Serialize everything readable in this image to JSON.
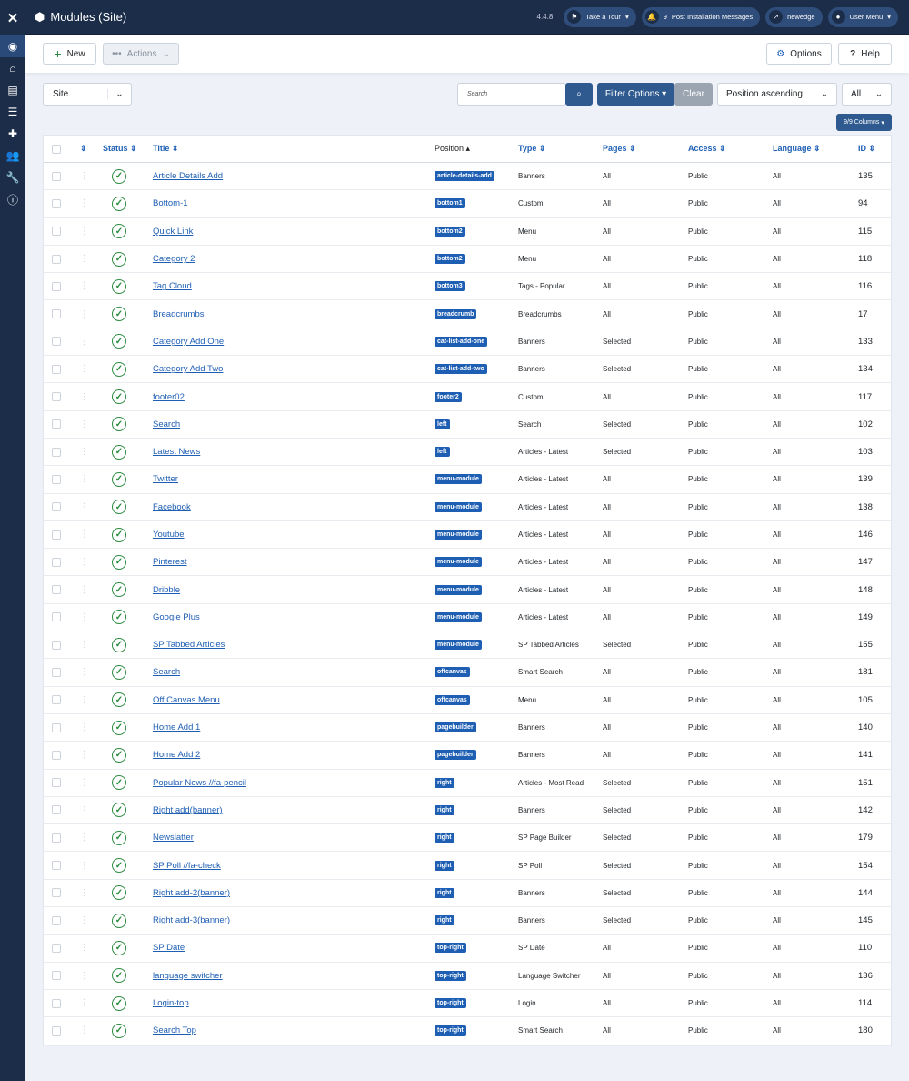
{
  "header": {
    "title": "Modules (Site)",
    "version": "4.4.8",
    "take_tour": "Take a Tour",
    "notif_count": "9",
    "post_install": "Post Installation Messages",
    "site_name": "newedge",
    "user_menu": "User Menu"
  },
  "toolbar": {
    "new": "New",
    "actions": "Actions",
    "options": "Options",
    "help": "Help"
  },
  "filters": {
    "client": "Site",
    "search_placeholder": "Search",
    "filter_options": "Filter Options",
    "clear": "Clear",
    "ordering": "Position ascending",
    "limit": "All",
    "columns": "9/9 Columns"
  },
  "table": {
    "headers": {
      "status": "Status",
      "title": "Title",
      "position": "Position",
      "type": "Type",
      "pages": "Pages",
      "access": "Access",
      "language": "Language",
      "id": "ID"
    },
    "rows": [
      [
        "Article Details Add",
        "article-details-add",
        "Banners",
        "All",
        "Public",
        "All",
        "135"
      ],
      [
        "Bottom-1",
        "bottom1",
        "Custom",
        "All",
        "Public",
        "All",
        "94"
      ],
      [
        "Quick Link",
        "bottom2",
        "Menu",
        "All",
        "Public",
        "All",
        "115"
      ],
      [
        "Category 2",
        "bottom2",
        "Menu",
        "All",
        "Public",
        "All",
        "118"
      ],
      [
        "Tag Cloud",
        "bottom3",
        "Tags - Popular",
        "All",
        "Public",
        "All",
        "116"
      ],
      [
        "Breadcrumbs",
        "breadcrumb",
        "Breadcrumbs",
        "All",
        "Public",
        "All",
        "17"
      ],
      [
        "Category Add One",
        "cat-list-add-one",
        "Banners",
        "Selected",
        "Public",
        "All",
        "133"
      ],
      [
        "Category Add Two",
        "cat-list-add-two",
        "Banners",
        "Selected",
        "Public",
        "All",
        "134"
      ],
      [
        "footer02",
        "footer2",
        "Custom",
        "All",
        "Public",
        "All",
        "117"
      ],
      [
        "Search",
        "left",
        "Search",
        "Selected",
        "Public",
        "All",
        "102"
      ],
      [
        "Latest News",
        "left",
        "Articles - Latest",
        "Selected",
        "Public",
        "All",
        "103"
      ],
      [
        "Twitter",
        "menu-module",
        "Articles - Latest",
        "All",
        "Public",
        "All",
        "139"
      ],
      [
        "Facebook",
        "menu-module",
        "Articles - Latest",
        "All",
        "Public",
        "All",
        "138"
      ],
      [
        "Youtube",
        "menu-module",
        "Articles - Latest",
        "All",
        "Public",
        "All",
        "146"
      ],
      [
        "Pinterest",
        "menu-module",
        "Articles - Latest",
        "All",
        "Public",
        "All",
        "147"
      ],
      [
        "Dribble",
        "menu-module",
        "Articles - Latest",
        "All",
        "Public",
        "All",
        "148"
      ],
      [
        "Google Plus",
        "menu-module",
        "Articles - Latest",
        "All",
        "Public",
        "All",
        "149"
      ],
      [
        "SP Tabbed Articles",
        "menu-module",
        "SP Tabbed Articles",
        "Selected",
        "Public",
        "All",
        "155"
      ],
      [
        "Search",
        "offcanvas",
        "Smart Search",
        "All",
        "Public",
        "All",
        "181"
      ],
      [
        "Off Canvas Menu",
        "offcanvas",
        "Menu",
        "All",
        "Public",
        "All",
        "105"
      ],
      [
        "Home Add 1",
        "pagebuilder",
        "Banners",
        "All",
        "Public",
        "All",
        "140"
      ],
      [
        "Home Add 2",
        "pagebuilder",
        "Banners",
        "All",
        "Public",
        "All",
        "141"
      ],
      [
        "Popular News //fa-pencil",
        "right",
        "Articles - Most Read",
        "Selected",
        "Public",
        "All",
        "151"
      ],
      [
        "Right add(banner)",
        "right",
        "Banners",
        "Selected",
        "Public",
        "All",
        "142"
      ],
      [
        "Newslatter",
        "right",
        "SP Page Builder",
        "Selected",
        "Public",
        "All",
        "179"
      ],
      [
        "SP Poll //fa-check",
        "right",
        "SP Poll",
        "Selected",
        "Public",
        "All",
        "154"
      ],
      [
        "Right add-2(banner)",
        "right",
        "Banners",
        "Selected",
        "Public",
        "All",
        "144"
      ],
      [
        "Right add-3(banner)",
        "right",
        "Banners",
        "Selected",
        "Public",
        "All",
        "145"
      ],
      [
        "SP Date",
        "top-right",
        "SP Date",
        "All",
        "Public",
        "All",
        "110"
      ],
      [
        "language switcher",
        "top-right",
        "Language Switcher",
        "All",
        "Public",
        "All",
        "136"
      ],
      [
        "Login-top",
        "top-right",
        "Login",
        "All",
        "Public",
        "All",
        "114"
      ],
      [
        "Search Top",
        "top-right",
        "Smart Search",
        "All",
        "Public",
        "All",
        "180"
      ]
    ]
  }
}
